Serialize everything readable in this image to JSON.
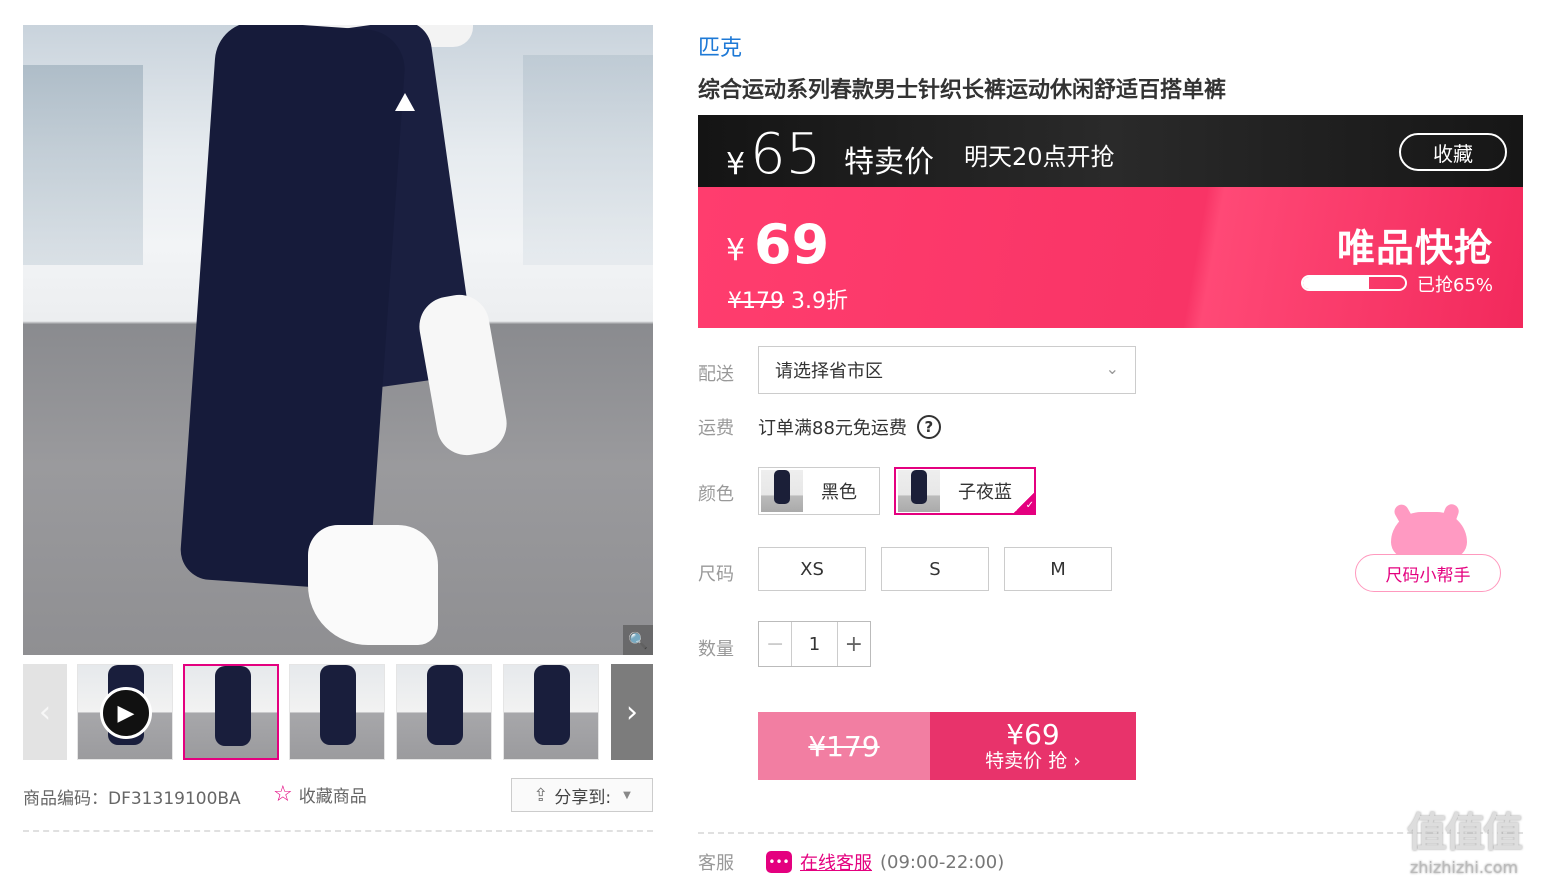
{
  "gallery": {
    "zoom_icon": "magnifier-icon",
    "prev_icon": "chevron-left-icon",
    "next_icon": "chevron-right-icon",
    "thumbnails": [
      "video",
      "image-2",
      "image-3",
      "image-4",
      "image-5"
    ],
    "active_index": 1
  },
  "meta": {
    "code_label": "商品编码：DF31319100BA",
    "favorite_label": "收藏商品",
    "share_label": "分享到:"
  },
  "product": {
    "brand": "匹克",
    "title": "综合运动系列春款男士针织长裤运动休闲舒适百搭单裤"
  },
  "flash_sale": {
    "currency": "¥",
    "special_price": "65",
    "special_label": "特卖价",
    "start_time": "明天20点开抢",
    "favorite_btn": "收藏",
    "current_price": "69",
    "original_price": "¥179",
    "discount": "3.9折",
    "vip_label": "唯品快抢",
    "sold_fraction": 0.65,
    "sold_text": "已抢65%"
  },
  "delivery": {
    "label": "配送",
    "placeholder": "请选择省市区"
  },
  "shipping": {
    "label": "运费",
    "text": "订单满88元免运费",
    "help_icon": "?"
  },
  "colors": {
    "label": "颜色",
    "options": [
      "黑色",
      "子夜蓝"
    ],
    "selected": "子夜蓝"
  },
  "sizes": {
    "label": "尺码",
    "options": [
      "XS",
      "S",
      "M"
    ],
    "helper": "尺码小帮手"
  },
  "quantity": {
    "label": "数量",
    "value": "1",
    "minus": "−",
    "plus": "+"
  },
  "buy": {
    "original": "¥179",
    "price": "¥69",
    "action": "特卖价 抢 ›"
  },
  "service": {
    "label": "客服",
    "link": "在线客服",
    "hours": "(09:00-22:00)"
  },
  "watermark": {
    "mark": "值值值",
    "site": "zhizhizhi.com"
  },
  "colors_theme": {
    "accent": "#e4007f",
    "flash_pink": "#f83466",
    "brand_blue": "#1e79d6"
  }
}
